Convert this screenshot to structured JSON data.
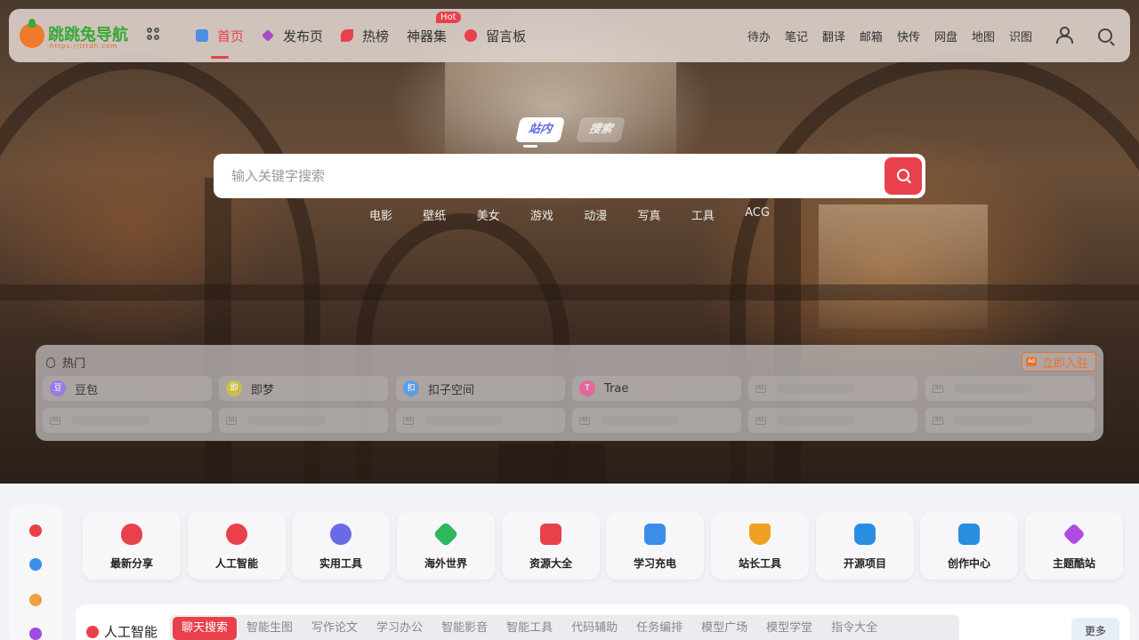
{
  "header": {
    "logo_text": "跳跳兔导航",
    "logo_sub": "https://tttdh.com",
    "nav": [
      {
        "label": "首页",
        "active": true,
        "icon": "home-icon",
        "color": "#4a90e2"
      },
      {
        "label": "发布页",
        "active": false,
        "icon": "diamond-icon",
        "color": "#a64ac9"
      },
      {
        "label": "热榜",
        "active": false,
        "icon": "rocket-icon",
        "color": "#e8414b"
      },
      {
        "label": "神器集",
        "active": false,
        "icon": "",
        "badge": "Hot"
      },
      {
        "label": "留言板",
        "active": false,
        "icon": "chat-icon",
        "color": "#e8414b"
      }
    ],
    "right_links": [
      "待办",
      "笔记",
      "翻译",
      "邮箱",
      "快传",
      "网盘",
      "地图",
      "识图"
    ]
  },
  "search": {
    "tab_active": "站内",
    "tab_inactive": "搜索",
    "placeholder": "输入关键字搜索",
    "quick_links": [
      "电影",
      "壁纸",
      "美女",
      "游戏",
      "动漫",
      "写真",
      "工具",
      "ACG"
    ]
  },
  "hot": {
    "title": "热门",
    "join_label": "立即入驻",
    "join_badge": "Ad",
    "ad_tag": "Ad",
    "items": [
      {
        "label": "豆包",
        "avatar": "豆",
        "color": "#9b7be0"
      },
      {
        "label": "即梦",
        "avatar": "即",
        "color": "#c8c04a"
      },
      {
        "label": "扣子空间",
        "avatar": "扣",
        "color": "#5a9ee0"
      },
      {
        "label": "Trae",
        "avatar": "T",
        "color": "#e06a9a"
      }
    ]
  },
  "categories": [
    {
      "label": "最新分享",
      "color": "#e8414b"
    },
    {
      "label": "人工智能",
      "color": "#e8414b"
    },
    {
      "label": "实用工具",
      "color": "#6a6ae8"
    },
    {
      "label": "海外世界",
      "color": "#2eb85c"
    },
    {
      "label": "资源大全",
      "color": "#e8414b"
    },
    {
      "label": "学习充电",
      "color": "#3a8ee8"
    },
    {
      "label": "站长工具",
      "color": "#f0a020"
    },
    {
      "label": "开源项目",
      "color": "#2a8ee0"
    },
    {
      "label": "创作中心",
      "color": "#2a8ee0"
    },
    {
      "label": "主题酷站",
      "color": "#b04ae0"
    }
  ],
  "rail_colors": [
    "#e8414b",
    "#3a8ee8",
    "#f0a040",
    "#a04ae0"
  ],
  "ai": {
    "title": "人工智能",
    "tabs": [
      "聊天搜索",
      "智能生图",
      "写作论文",
      "学习办公",
      "智能影音",
      "智能工具",
      "代码辅助",
      "任务编排",
      "模型广场",
      "模型学堂",
      "指令大全"
    ],
    "more_label": "更多"
  }
}
